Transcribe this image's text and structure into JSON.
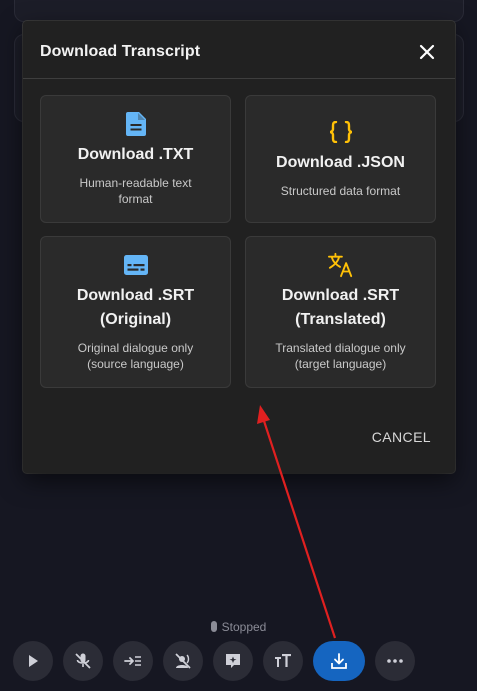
{
  "dialog": {
    "title": "Download Transcript",
    "cancel_label": "CANCEL",
    "options": [
      {
        "label": "Download .TXT",
        "description": "Human-readable text format",
        "icon": "document-icon",
        "icon_color": "#64b5f6"
      },
      {
        "label": "Download .JSON",
        "description": "Structured data format",
        "icon": "braces-icon",
        "icon_color": "#ffc107"
      },
      {
        "label": "Download .SRT (Original)",
        "description": "Original dialogue only (source language)",
        "icon": "subtitles-icon",
        "icon_color": "#64b5f6"
      },
      {
        "label": "Download .SRT (Translated)",
        "description": "Translated dialogue only (target language)",
        "icon": "translate-icon",
        "icon_color": "#ffc107"
      }
    ]
  },
  "status": {
    "text": "Stopped"
  },
  "toolbar": {
    "buttons": [
      "play-icon",
      "mic-off-icon",
      "input-icon",
      "voice-off-icon",
      "add-comment-icon",
      "text-size-icon",
      "download-icon",
      "more-icon"
    ],
    "primary_color": "#1565c0"
  },
  "annotation": {
    "arrow_color": "#e02020"
  }
}
